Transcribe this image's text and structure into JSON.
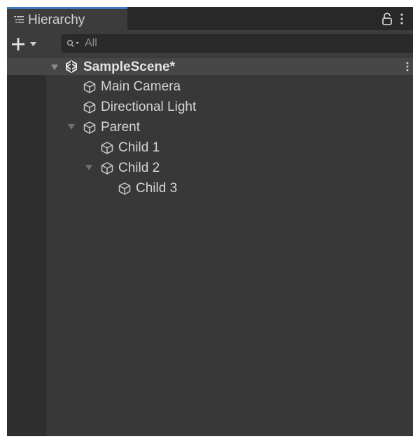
{
  "tab": {
    "title": "Hierarchy",
    "icon": "hierarchy-list-icon",
    "active_color": "#3a79bb"
  },
  "toolbar": {
    "add_icon": "plus-icon",
    "dropdown_icon": "triangle-down-icon",
    "search_placeholder": "All",
    "search_icon": "search-icon"
  },
  "scene": {
    "name": "SampleScene*",
    "icon": "unity-scene-icon",
    "expanded": true
  },
  "tree": {
    "items": [
      {
        "label": "Main Camera",
        "icon": "gameobject-cube-icon",
        "depth": 1,
        "expandable": false
      },
      {
        "label": "Directional Light",
        "icon": "gameobject-cube-icon",
        "depth": 1,
        "expandable": false
      },
      {
        "label": "Parent",
        "icon": "gameobject-cube-icon",
        "depth": 1,
        "expandable": true,
        "expanded": true
      },
      {
        "label": "Child 1",
        "icon": "gameobject-cube-icon",
        "depth": 2,
        "expandable": false
      },
      {
        "label": "Child 2",
        "icon": "gameobject-cube-icon",
        "depth": 2,
        "expandable": true,
        "expanded": true
      },
      {
        "label": "Child 3",
        "icon": "gameobject-cube-icon",
        "depth": 3,
        "expandable": false
      }
    ]
  },
  "colors": {
    "panel_bg": "#383838",
    "gutter_bg": "#2e2e2e",
    "scene_row_bg": "#474747",
    "text": "#d4d4d4"
  }
}
